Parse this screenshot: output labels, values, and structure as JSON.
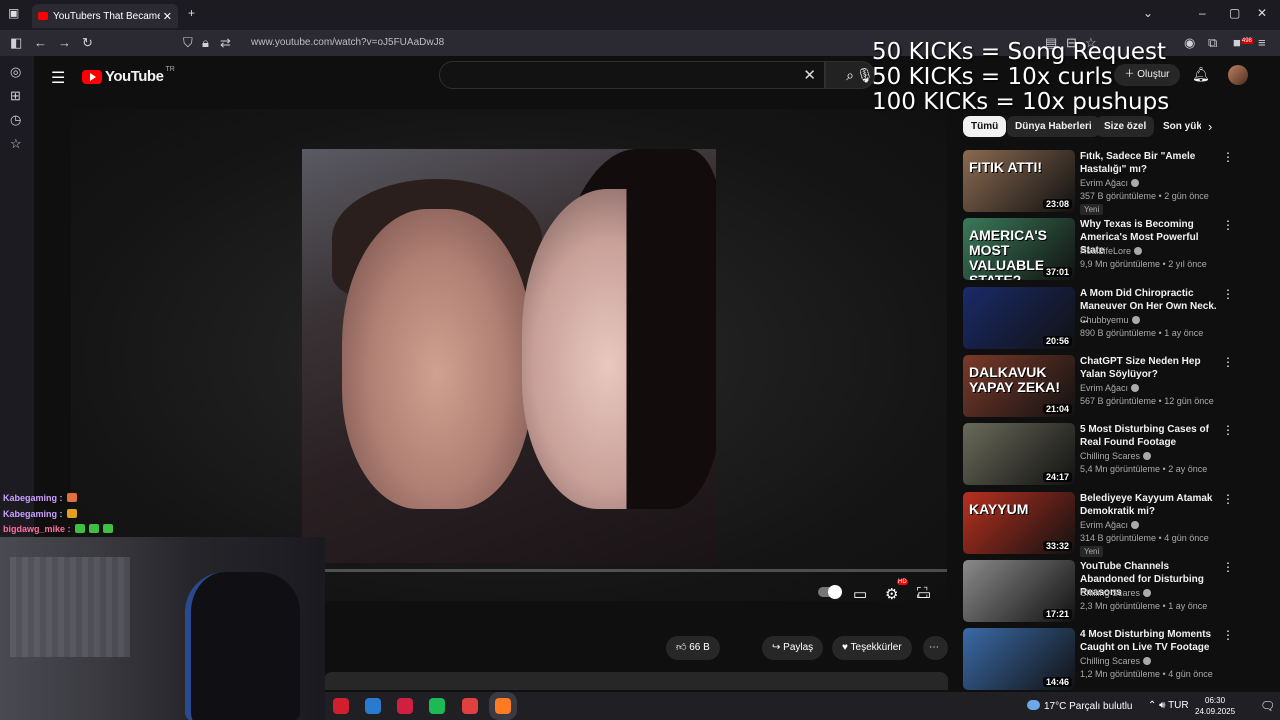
{
  "browser": {
    "tab_title": "YouTubers That Became Murde",
    "url": "www.youtube.com/watch?v=oJ5FUAaDwJ8",
    "extension_badge": "498"
  },
  "youtube": {
    "logo_text": "YouTube",
    "logo_region": "TR",
    "create_label": "Oluştur"
  },
  "overlay": {
    "lines": [
      "50 KICKs = Song Request",
      "50 KICKs = 10x curls",
      "100 KICKs = 10x pushups"
    ]
  },
  "player": {
    "progress_fraction": 0.05,
    "autoplay": true,
    "settings_badge": "HD"
  },
  "actions": {
    "likes": "66 B",
    "share": "Paylaş",
    "thanks": "Teşekkürler"
  },
  "chips": [
    "Tümü",
    "Dünya Haberleri",
    "Size özel",
    "Son yük"
  ],
  "recommendations": [
    {
      "title": "Fıtık, Sadece Bir \"Amele Hastalığı\" mı?",
      "channel": "Evrim Ağacı",
      "meta": "357 B görüntüleme • 2 gün önce",
      "badge": "Yeni",
      "duration": "23:08",
      "thumb_text": "FITIK ATTI!",
      "thumb_color": "#8a6a50"
    },
    {
      "title": "Why Texas is Becoming America's Most Powerful State",
      "channel": "RealLifeLore",
      "meta": "9,9 Mn görüntüleme • 2 yıl önce",
      "badge": "",
      "duration": "37:01",
      "thumb_text": "AMERICA'S MOST VALUABLE STATE?",
      "thumb_color": "#3a7a5a"
    },
    {
      "title": "A Mom Did Chiropractic Maneuver On Her Own Neck. ...",
      "channel": "Chubbyemu",
      "meta": "890 B görüntüleme • 1 ay önce",
      "badge": "",
      "duration": "20:56",
      "thumb_text": "",
      "thumb_color": "#1a2a6a"
    },
    {
      "title": "ChatGPT Size Neden Hep Yalan Söylüyor?",
      "channel": "Evrim Ağacı",
      "meta": "567 B görüntüleme • 12 gün önce",
      "badge": "",
      "duration": "21:04",
      "thumb_text": "DALKAVUK YAPAY ZEKA!",
      "thumb_color": "#7a3a2a"
    },
    {
      "title": "5 Most Disturbing Cases of Real Found Footage",
      "channel": "Chilling Scares",
      "meta": "5,4 Mn görüntüleme • 2 ay önce",
      "badge": "",
      "duration": "24:17",
      "thumb_text": "",
      "thumb_color": "#6a6a5a"
    },
    {
      "title": "Belediyeye Kayyum Atamak Demokratik mi?",
      "channel": "Evrim Ağacı",
      "meta": "314 B görüntüleme • 4 gün önce",
      "badge": "Yeni",
      "duration": "33:32",
      "thumb_text": "KAYYUM",
      "thumb_color": "#b83020"
    },
    {
      "title": "YouTube Channels Abandoned for Disturbing Reasons",
      "channel": "Chilling Scares",
      "meta": "2,3 Mn görüntüleme • 1 ay önce",
      "badge": "",
      "duration": "17:21",
      "thumb_text": "",
      "thumb_color": "#8a8a8a"
    },
    {
      "title": "4 Most Disturbing Moments Caught on Live TV Footage",
      "channel": "Chilling Scares",
      "meta": "1,2 Mn görüntüleme • 4 gün önce",
      "badge": "",
      "duration": "14:46",
      "thumb_text": "",
      "thumb_color": "#3a6aa8"
    }
  ],
  "chat": [
    {
      "user": "Kabegaming",
      "emotes": [
        "#e07040"
      ],
      "style": "u1"
    },
    {
      "user": "Kabegaming",
      "emotes": [
        "#e0a020"
      ],
      "style": "u1"
    },
    {
      "user": "bigdawg_mike",
      "emotes": [
        "#40c040",
        "#40c040",
        "#40c040"
      ],
      "style": "u2"
    }
  ],
  "taskbar": {
    "weather": "17°C  Parçalı bulutlu",
    "lang": "TUR",
    "time": "06:30",
    "date": "24.09.2025",
    "apps": [
      "#d02030",
      "#2a7ad0",
      "#d02040",
      "#1db954",
      "#e04040",
      "#ff7a20"
    ]
  }
}
